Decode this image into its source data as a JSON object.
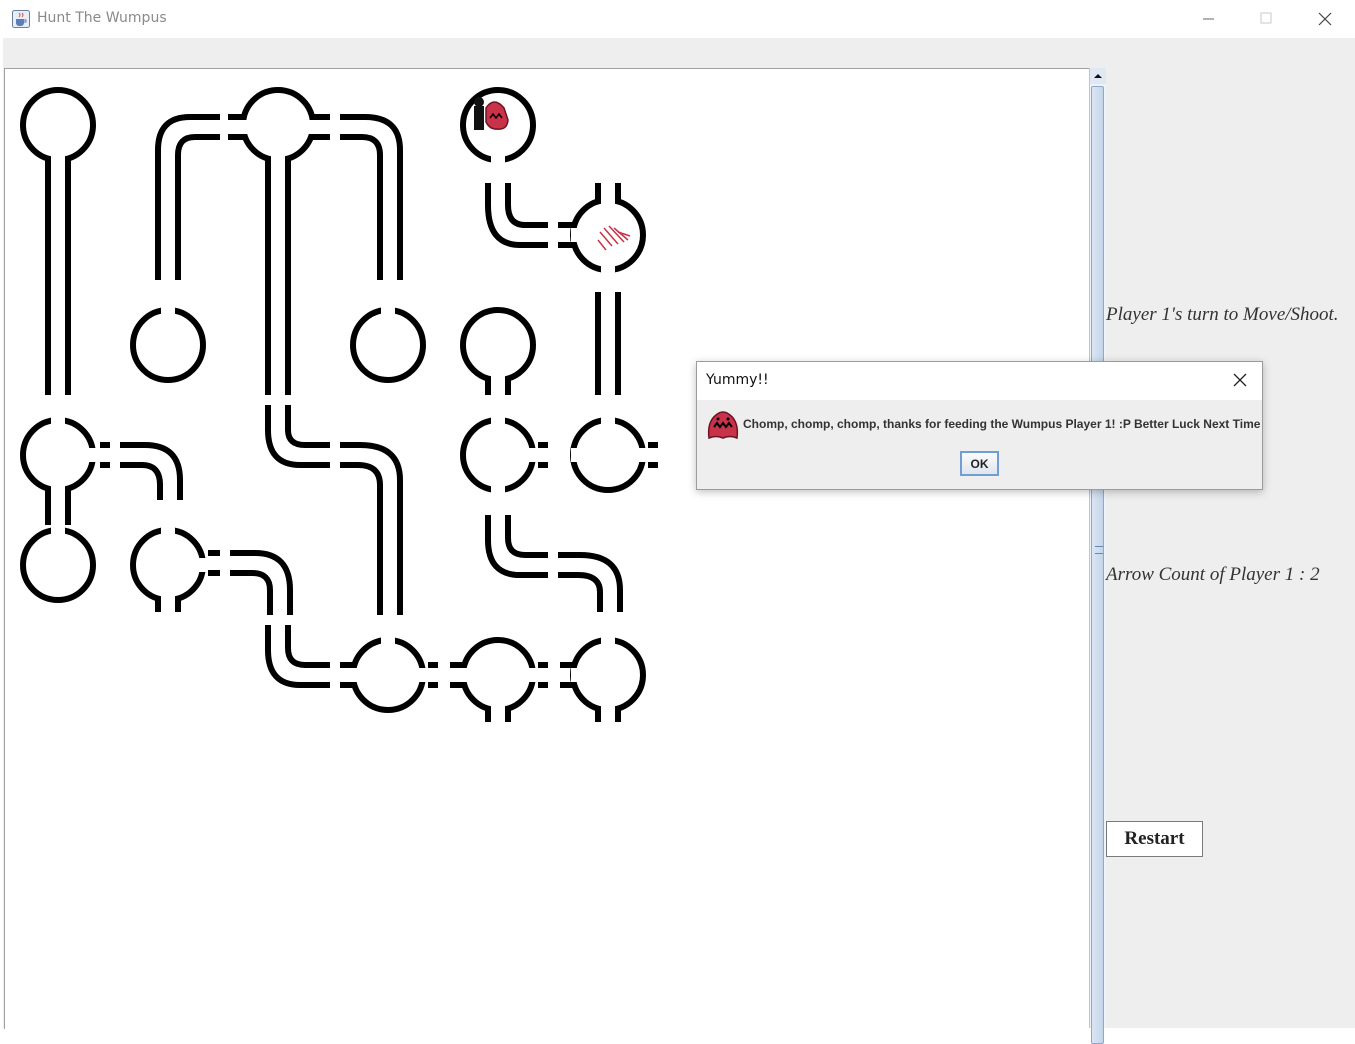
{
  "window": {
    "title": "Hunt The Wumpus",
    "icon": "java-cup-icon"
  },
  "side_panel": {
    "turn_label": "Player 1's turn to Move/Shoot.",
    "arrow_label": "Arrow Count of Player 1 : 2",
    "restart_label": "Restart"
  },
  "dialog": {
    "title": "Yummy!!",
    "message": "Chomp, chomp, chomp, thanks for feeding the Wumpus Player 1! :P Better Luck Next Time",
    "ok_label": "OK",
    "icon": "wumpus-icon"
  },
  "board": {
    "player_room": "player-with-wumpus",
    "marked_room": "blood-scratch"
  },
  "colors": {
    "wumpus": "#c8334a",
    "focus": "#6f9fd2"
  }
}
